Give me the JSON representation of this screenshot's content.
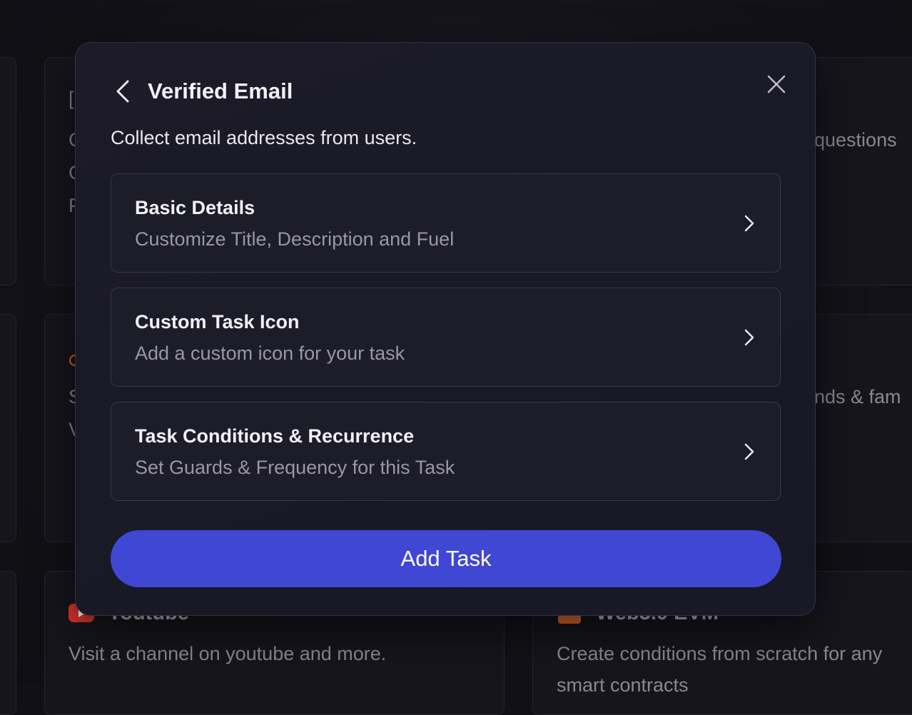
{
  "background": {
    "cards": [
      {
        "title": "",
        "lines": [
          "[",
          "C",
          "C",
          "P"
        ]
      },
      {
        "title": "",
        "lines": [
          "questions"
        ]
      },
      {
        "title": "",
        "lines": [
          "S",
          "V"
        ]
      },
      {
        "title": "",
        "lines": [
          "nds & fam"
        ]
      },
      {
        "title": "Youtube",
        "lines": [
          "Visit a channel on youtube and more."
        ]
      },
      {
        "title": "Web3.0 EVM",
        "lines": [
          "Create conditions from scratch for any",
          "smart contracts"
        ]
      }
    ]
  },
  "modal": {
    "title": "Verified Email",
    "description": "Collect email addresses from users.",
    "options": [
      {
        "title": "Basic Details",
        "subtitle": "Customize Title, Description and Fuel"
      },
      {
        "title": "Custom Task Icon",
        "subtitle": "Add a custom icon for your task"
      },
      {
        "title": "Task Conditions & Recurrence",
        "subtitle": "Set Guards & Frequency for this Task"
      }
    ],
    "primary_button": "Add Task"
  },
  "colors": {
    "accent": "#3f47d3",
    "modal_bg": "#1c1b27",
    "card_border": "#3a3846",
    "muted_text": "#9997a2"
  },
  "icons": {
    "back": "chevron-left-icon",
    "close": "close-icon",
    "option": "chevron-right-icon",
    "youtube": "youtube-icon",
    "web3": "web3-icon"
  }
}
